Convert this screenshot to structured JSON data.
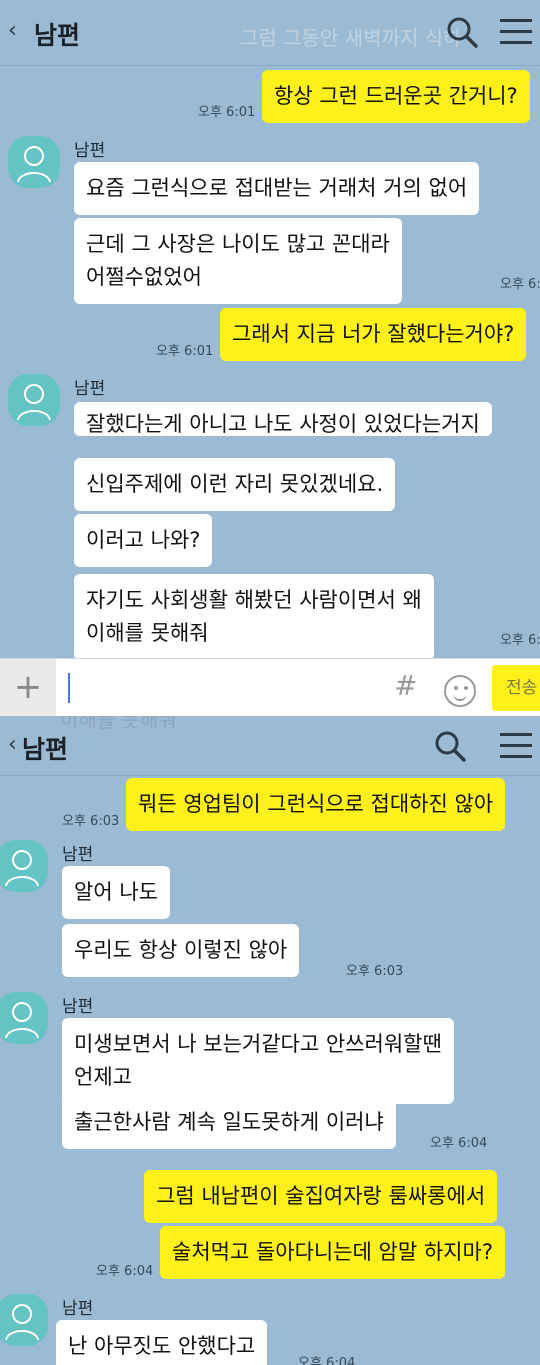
{
  "top_screen": {
    "header": {
      "back_glyph": "‹",
      "title": "남편",
      "ghost_text": "그럼 그동안 새벽까지 식하"
    },
    "messages": {
      "m1": {
        "text": "항상 그런 드러운곳 간거니?",
        "time": "오후 6:01"
      },
      "g1": {
        "sender": "남편"
      },
      "m2": {
        "text": "요즘 그런식으로 접대받는 거래처 거의 없어"
      },
      "m3": {
        "line1": "근데 그 사장은 나이도 많고 꼰대라",
        "line2": "어쩔수없었어",
        "time": "오후 6:"
      },
      "m4": {
        "text": "그래서 지금 너가 잘했다는거야?",
        "time": "오후 6:01"
      },
      "g2": {
        "sender": "남편"
      },
      "m5": {
        "text": "잘했다는게 아니고 나도 사정이 있었다는거지"
      },
      "m6": {
        "text": "신입주제에 이런 자리 못있겠네요."
      },
      "m7": {
        "text": "이러고 나와?"
      },
      "m8": {
        "line1": "자기도 사회생활 해봤던 사람이면서 왜",
        "line2": "이해를 못해줘",
        "time": "오후 6:"
      }
    },
    "input": {
      "plus_glyph": "+",
      "hash_glyph": "#",
      "send_label": "전송"
    }
  },
  "bottom_screen": {
    "header": {
      "back_glyph": "‹",
      "title": "남편",
      "peek_text": "이해를 못해줘"
    },
    "messages": {
      "m1": {
        "text": "뭐든 영업팀이 그런식으로 접대하진 않아",
        "time": "오후 6:03"
      },
      "g1": {
        "sender": "남편"
      },
      "m2": {
        "text": "알어 나도"
      },
      "m3": {
        "text": "우리도 항상 이렇진 않아",
        "time": "오후 6:03"
      },
      "g2": {
        "sender": "남편"
      },
      "m4": {
        "line1": "미생보면서 나 보는거같다고 안쓰러워할땐",
        "line2": "언제고"
      },
      "m5": {
        "text": "출근한사람 계속 일도못하게 이러냐",
        "time": "오후 6:04"
      },
      "m6": {
        "text": "그럼 내남편이 술집여자랑 룸싸롱에서"
      },
      "m7": {
        "text": "술처먹고 돌아다니는데 암말 하지마?",
        "time": "오후 6:04"
      },
      "g3": {
        "sender": "남편"
      },
      "m8": {
        "text": "난 아무짓도 안했다고",
        "time": "오후 6:04"
      }
    }
  },
  "colors": {
    "chat_background": "#9bbbd4",
    "outgoing_bubble": "#fef01b",
    "incoming_bubble": "#ffffff",
    "avatar": "#63c4c3"
  }
}
